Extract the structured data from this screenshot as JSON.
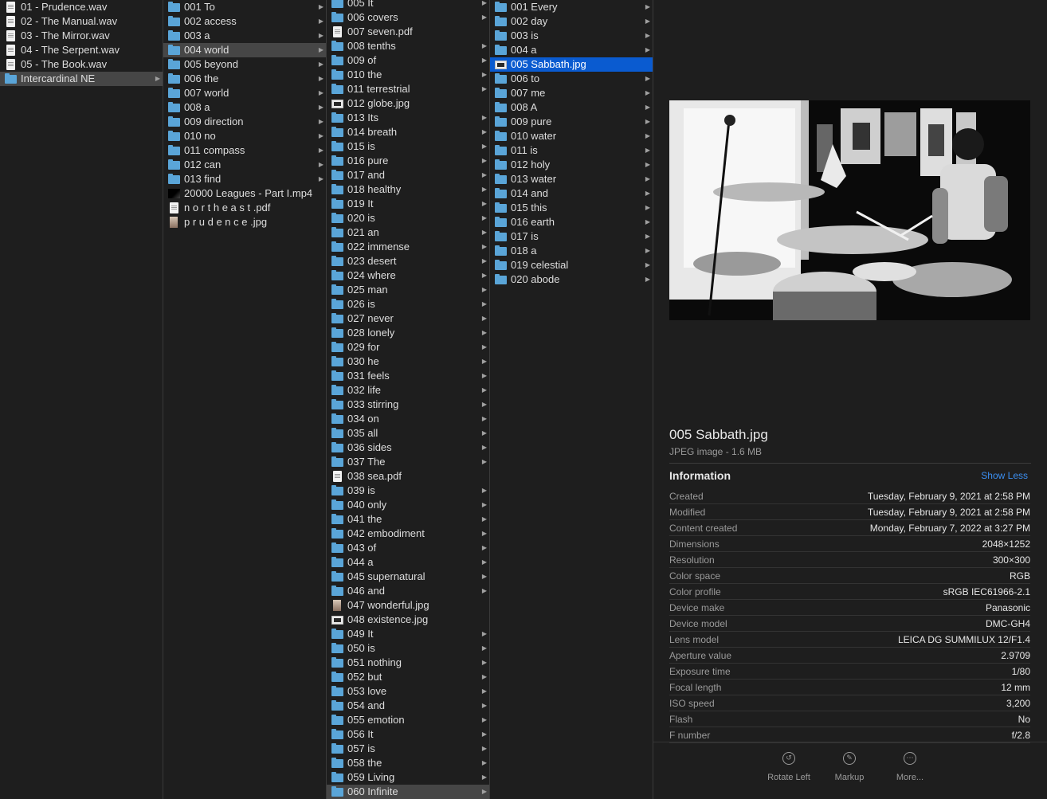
{
  "column1": [
    {
      "name": "01 - Prudence.wav",
      "kind": "doc",
      "folder": false
    },
    {
      "name": "02 - The Manual.wav",
      "kind": "doc",
      "folder": false
    },
    {
      "name": "03 - The Mirror.wav",
      "kind": "doc",
      "folder": false
    },
    {
      "name": "04 - The Serpent.wav",
      "kind": "doc",
      "folder": false
    },
    {
      "name": "05 - The Book.wav",
      "kind": "doc",
      "folder": false
    },
    {
      "name": "Intercardinal NE",
      "kind": "folder",
      "folder": true,
      "selected": "gray"
    }
  ],
  "column2": [
    {
      "name": "001 To",
      "kind": "folder",
      "folder": true
    },
    {
      "name": "002 access",
      "kind": "folder",
      "folder": true
    },
    {
      "name": "003 a",
      "kind": "folder",
      "folder": true
    },
    {
      "name": "004 world",
      "kind": "folder",
      "folder": true,
      "selected": "gray"
    },
    {
      "name": "005 beyond",
      "kind": "folder",
      "folder": true
    },
    {
      "name": "006 the",
      "kind": "folder",
      "folder": true
    },
    {
      "name": "007 world",
      "kind": "folder",
      "folder": true
    },
    {
      "name": "008 a",
      "kind": "folder",
      "folder": true
    },
    {
      "name": "009 direction",
      "kind": "folder",
      "folder": true
    },
    {
      "name": "010 no",
      "kind": "folder",
      "folder": true
    },
    {
      "name": "011 compass",
      "kind": "folder",
      "folder": true
    },
    {
      "name": "012 can",
      "kind": "folder",
      "folder": true
    },
    {
      "name": "013 find",
      "kind": "folder",
      "folder": true
    },
    {
      "name": "20000 Leagues - Part I.mp4",
      "kind": "video",
      "folder": false
    },
    {
      "name": "n o r t h e a s t .pdf",
      "kind": "doc",
      "folder": false
    },
    {
      "name": "p r u d e n c e .jpg",
      "kind": "photo",
      "folder": false
    }
  ],
  "column3": [
    {
      "name": "005 It",
      "kind": "folder",
      "folder": true
    },
    {
      "name": "006 covers",
      "kind": "folder",
      "folder": true
    },
    {
      "name": "007 seven.pdf",
      "kind": "doc",
      "folder": false
    },
    {
      "name": "008 tenths",
      "kind": "folder",
      "folder": true
    },
    {
      "name": "009 of",
      "kind": "folder",
      "folder": true
    },
    {
      "name": "010 the",
      "kind": "folder",
      "folder": true
    },
    {
      "name": "011 terrestrial",
      "kind": "folder",
      "folder": true
    },
    {
      "name": "012 globe.jpg",
      "kind": "image",
      "folder": false
    },
    {
      "name": "013 Its",
      "kind": "folder",
      "folder": true
    },
    {
      "name": "014 breath",
      "kind": "folder",
      "folder": true
    },
    {
      "name": "015 is",
      "kind": "folder",
      "folder": true
    },
    {
      "name": "016 pure",
      "kind": "folder",
      "folder": true
    },
    {
      "name": "017 and",
      "kind": "folder",
      "folder": true
    },
    {
      "name": "018 healthy",
      "kind": "folder",
      "folder": true
    },
    {
      "name": "019 It",
      "kind": "folder",
      "folder": true
    },
    {
      "name": "020 is",
      "kind": "folder",
      "folder": true
    },
    {
      "name": "021 an",
      "kind": "folder",
      "folder": true
    },
    {
      "name": "022 immense",
      "kind": "folder",
      "folder": true
    },
    {
      "name": "023 desert",
      "kind": "folder",
      "folder": true
    },
    {
      "name": "024 where",
      "kind": "folder",
      "folder": true
    },
    {
      "name": "025 man",
      "kind": "folder",
      "folder": true
    },
    {
      "name": "026 is",
      "kind": "folder",
      "folder": true
    },
    {
      "name": "027 never",
      "kind": "folder",
      "folder": true
    },
    {
      "name": "028 lonely",
      "kind": "folder",
      "folder": true
    },
    {
      "name": "029 for",
      "kind": "folder",
      "folder": true
    },
    {
      "name": "030 he",
      "kind": "folder",
      "folder": true
    },
    {
      "name": "031 feels",
      "kind": "folder",
      "folder": true
    },
    {
      "name": "032 life",
      "kind": "folder",
      "folder": true
    },
    {
      "name": "033 stirring",
      "kind": "folder",
      "folder": true
    },
    {
      "name": "034 on",
      "kind": "folder",
      "folder": true
    },
    {
      "name": "035 all",
      "kind": "folder",
      "folder": true
    },
    {
      "name": "036 sides",
      "kind": "folder",
      "folder": true
    },
    {
      "name": "037 The",
      "kind": "folder",
      "folder": true
    },
    {
      "name": "038 sea.pdf",
      "kind": "doc",
      "folder": false
    },
    {
      "name": "039 is",
      "kind": "folder",
      "folder": true
    },
    {
      "name": "040 only",
      "kind": "folder",
      "folder": true
    },
    {
      "name": "041 the",
      "kind": "folder",
      "folder": true
    },
    {
      "name": "042 embodiment",
      "kind": "folder",
      "folder": true
    },
    {
      "name": "043 of",
      "kind": "folder",
      "folder": true
    },
    {
      "name": "044 a",
      "kind": "folder",
      "folder": true
    },
    {
      "name": "045 supernatural",
      "kind": "folder",
      "folder": true
    },
    {
      "name": "046 and",
      "kind": "folder",
      "folder": true
    },
    {
      "name": "047 wonderful.jpg",
      "kind": "photo",
      "folder": false
    },
    {
      "name": "048 existence.jpg",
      "kind": "image",
      "folder": false
    },
    {
      "name": "049 It",
      "kind": "folder",
      "folder": true
    },
    {
      "name": "050 is",
      "kind": "folder",
      "folder": true
    },
    {
      "name": "051 nothing",
      "kind": "folder",
      "folder": true
    },
    {
      "name": "052 but",
      "kind": "folder",
      "folder": true
    },
    {
      "name": "053 love",
      "kind": "folder",
      "folder": true
    },
    {
      "name": "054 and",
      "kind": "folder",
      "folder": true
    },
    {
      "name": "055 emotion",
      "kind": "folder",
      "folder": true
    },
    {
      "name": "056 It",
      "kind": "folder",
      "folder": true
    },
    {
      "name": "057 is",
      "kind": "folder",
      "folder": true
    },
    {
      "name": "058 the",
      "kind": "folder",
      "folder": true
    },
    {
      "name": "059 Living",
      "kind": "folder",
      "folder": true
    },
    {
      "name": "060 Infinite",
      "kind": "folder",
      "folder": true,
      "selected": "gray"
    }
  ],
  "column4": [
    {
      "name": "001 Every",
      "kind": "folder",
      "folder": true
    },
    {
      "name": "002 day",
      "kind": "folder",
      "folder": true
    },
    {
      "name": "003 is",
      "kind": "folder",
      "folder": true
    },
    {
      "name": "004 a",
      "kind": "folder",
      "folder": true
    },
    {
      "name": "005 Sabbath.jpg",
      "kind": "image",
      "folder": false,
      "selected": "blue"
    },
    {
      "name": "006 to",
      "kind": "folder",
      "folder": true
    },
    {
      "name": "007 me",
      "kind": "folder",
      "folder": true
    },
    {
      "name": "008 A",
      "kind": "folder",
      "folder": true
    },
    {
      "name": "009 pure",
      "kind": "folder",
      "folder": true
    },
    {
      "name": "010 water",
      "kind": "folder",
      "folder": true
    },
    {
      "name": "011 is",
      "kind": "folder",
      "folder": true
    },
    {
      "name": "012 holy",
      "kind": "folder",
      "folder": true
    },
    {
      "name": "013 water",
      "kind": "folder",
      "folder": true
    },
    {
      "name": "014 and",
      "kind": "folder",
      "folder": true
    },
    {
      "name": "015 this",
      "kind": "folder",
      "folder": true
    },
    {
      "name": "016 earth",
      "kind": "folder",
      "folder": true
    },
    {
      "name": "017 is",
      "kind": "folder",
      "folder": true
    },
    {
      "name": "018 a",
      "kind": "folder",
      "folder": true
    },
    {
      "name": "019 celestial",
      "kind": "folder",
      "folder": true
    },
    {
      "name": "020 abode",
      "kind": "folder",
      "folder": true
    }
  ],
  "preview": {
    "file_name": "005 Sabbath.jpg",
    "file_subtitle": "JPEG image - 1.6 MB",
    "info_title": "Information",
    "show_less": "Show Less",
    "info": [
      {
        "label": "Created",
        "value": "Tuesday, February 9, 2021 at 2:58 PM"
      },
      {
        "label": "Modified",
        "value": "Tuesday, February 9, 2021 at 2:58 PM"
      },
      {
        "label": "Content created",
        "value": "Monday, February 7, 2022 at 3:27 PM"
      },
      {
        "label": "Dimensions",
        "value": "2048×1252"
      },
      {
        "label": "Resolution",
        "value": "300×300"
      },
      {
        "label": "Color space",
        "value": "RGB"
      },
      {
        "label": "Color profile",
        "value": "sRGB IEC61966-2.1"
      },
      {
        "label": "Device make",
        "value": "Panasonic"
      },
      {
        "label": "Device model",
        "value": "DMC-GH4"
      },
      {
        "label": "Lens model",
        "value": "LEICA DG SUMMILUX 12/F1.4"
      },
      {
        "label": "Aperture value",
        "value": "2.9709"
      },
      {
        "label": "Exposure time",
        "value": "1/80"
      },
      {
        "label": "Focal length",
        "value": "12 mm"
      },
      {
        "label": "ISO speed",
        "value": "3,200"
      },
      {
        "label": "Flash",
        "value": "No"
      },
      {
        "label": "F number",
        "value": "f/2.8"
      }
    ],
    "actions": {
      "rotate_left": "Rotate Left",
      "markup": "Markup",
      "more": "More..."
    }
  },
  "colors": {
    "background": "#1e1e1e",
    "selection_blue": "#0a5bd0",
    "selection_gray": "#464646",
    "folder": "#5aa5d8",
    "link": "#3b8ef0"
  }
}
